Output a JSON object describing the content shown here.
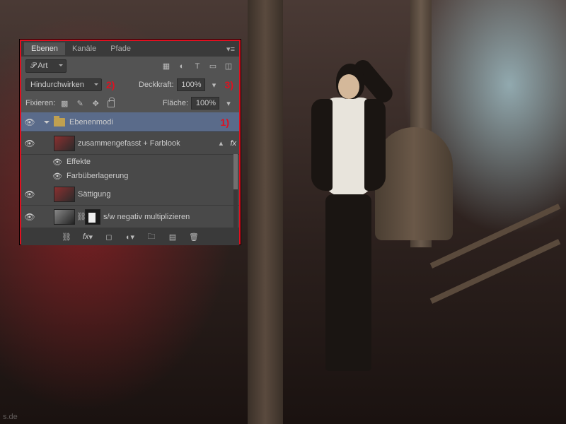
{
  "tabs": [
    "Ebenen",
    "Kanäle",
    "Pfade"
  ],
  "filter": {
    "kind": "𝒫 Art"
  },
  "blend": {
    "mode": "Hindurchwirken",
    "opacity_label": "Deckkraft:",
    "opacity": "100%"
  },
  "lock": {
    "label": "Fixieren:",
    "fill_label": "Fläche:",
    "fill": "100%"
  },
  "layers": [
    {
      "name": "Ebenenmodi",
      "type": "group"
    },
    {
      "name": "zusammengefasst + Farblook",
      "fx": "fx",
      "effects": [
        "Effekte",
        "Farbüberlagerung"
      ]
    },
    {
      "name": "Sättigung"
    },
    {
      "name": "s/w negativ multiplizieren"
    }
  ],
  "annot": {
    "a1": "1)",
    "a2": "2)",
    "a3": "3)"
  },
  "watermark": "s.de"
}
